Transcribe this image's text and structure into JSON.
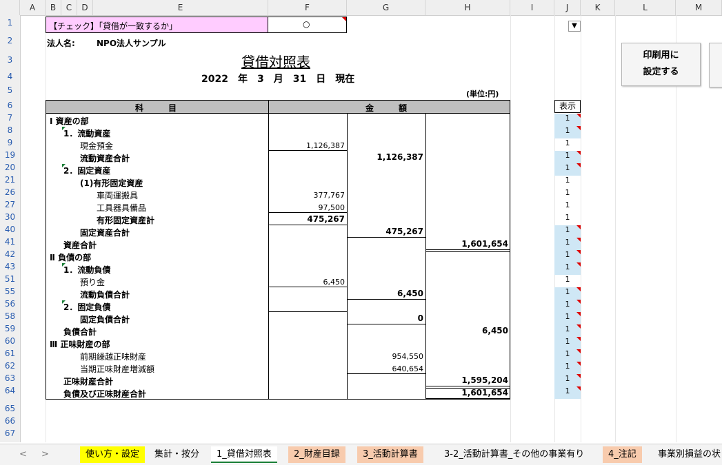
{
  "columns": [
    "A",
    "B",
    "C",
    "D",
    "E",
    "F",
    "G",
    "H",
    "I",
    "J",
    "K",
    "L",
    "M"
  ],
  "rows": [
    "1",
    "2",
    "3",
    "4",
    "5",
    "6",
    "7",
    "8",
    "9",
    "19",
    "20",
    "21",
    "26",
    "27",
    "30",
    "40",
    "41",
    "42",
    "43",
    "51",
    "55",
    "56",
    "58",
    "59",
    "60",
    "61",
    "62",
    "63",
    "64",
    "65",
    "66",
    "67"
  ],
  "check": {
    "label": "【チェック】「貸借が一致するか」",
    "result": "○"
  },
  "header": {
    "corp_label": "法人名:",
    "corp_name": "NPO法人サンプル",
    "title": "貸借対照表",
    "date": "2022　年　3　月　31　日　現在",
    "unit": "(単位:円)"
  },
  "table": {
    "col_subject": "科　　　目",
    "col_amount": "金　　　額",
    "rows": [
      {
        "label": "Ⅰ 資産の部",
        "f": "",
        "g": "",
        "h": "",
        "j": "1"
      },
      {
        "label": "1．流動資産",
        "f": "",
        "g": "",
        "h": "",
        "j": "1"
      },
      {
        "label": "現金預金",
        "f": "1,126,387",
        "g": "",
        "h": "",
        "j": "1"
      },
      {
        "label": "流動資産合計",
        "f": "",
        "g": "1,126,387",
        "h": "",
        "j": "1"
      },
      {
        "label": "2．固定資産",
        "f": "",
        "g": "",
        "h": "",
        "j": "1"
      },
      {
        "label": "(1)有形固定資産",
        "f": "",
        "g": "",
        "h": "",
        "j": "1"
      },
      {
        "label": "車両運搬具",
        "f": "377,767",
        "g": "",
        "h": "",
        "j": "1"
      },
      {
        "label": "工具器具備品",
        "f": "97,500",
        "g": "",
        "h": "",
        "j": "1"
      },
      {
        "label": "有形固定資産計",
        "f": "475,267",
        "g": "",
        "h": "",
        "j": "1"
      },
      {
        "label": "固定資産合計",
        "f": "",
        "g": "475,267",
        "h": "",
        "j": "1"
      },
      {
        "label": "資産合計",
        "f": "",
        "g": "",
        "h": "1,601,654",
        "j": "1"
      },
      {
        "label": "Ⅱ 負債の部",
        "f": "",
        "g": "",
        "h": "",
        "j": "1"
      },
      {
        "label": "1．流動負債",
        "f": "",
        "g": "",
        "h": "",
        "j": "1"
      },
      {
        "label": "預り金",
        "f": "6,450",
        "g": "",
        "h": "",
        "j": "1"
      },
      {
        "label": "流動負債合計",
        "f": "",
        "g": "6,450",
        "h": "",
        "j": "1"
      },
      {
        "label": "2．固定負債",
        "f": "",
        "g": "",
        "h": "",
        "j": "1"
      },
      {
        "label": "固定負債合計",
        "f": "",
        "g": "0",
        "h": "",
        "j": "1"
      },
      {
        "label": "負債合計",
        "f": "",
        "g": "",
        "h": "6,450",
        "j": "1"
      },
      {
        "label": "Ⅲ 正味財産の部",
        "f": "",
        "g": "",
        "h": "",
        "j": "1"
      },
      {
        "label": "前期繰越正味財産",
        "f": "",
        "g": "954,550",
        "h": "",
        "j": "1"
      },
      {
        "label": "当期正味財産増減額",
        "f": "",
        "g": "640,654",
        "h": "",
        "j": "1"
      },
      {
        "label": "正味財産合計",
        "f": "",
        "g": "",
        "h": "1,595,204",
        "j": "1"
      },
      {
        "label": "負債及び正味財産合計",
        "f": "",
        "g": "",
        "h": "1,601,654",
        "j": "1"
      }
    ]
  },
  "display_header": "表示",
  "buttons": {
    "print": "印刷用に\n設定する"
  },
  "tabs": [
    {
      "label": "使い方・設定",
      "color": "#ffff00"
    },
    {
      "label": "集計・按分",
      "color": ""
    },
    {
      "label": "1_貸借対照表",
      "color": "active"
    },
    {
      "label": "2_財産目録",
      "color": "#f8cbad"
    },
    {
      "label": "3_活動計算書",
      "color": "#f8cbad"
    },
    {
      "label": "3-2_活動計算書_その他の事業有り",
      "color": ""
    },
    {
      "label": "4_注記",
      "color": "#f8cbad"
    },
    {
      "label": "事業別損益の状",
      "color": ""
    }
  ],
  "nav": {
    "prev": "<",
    "next": ">"
  },
  "colors": {
    "pink": "#ffccff",
    "header_gray": "#bfbfbf",
    "blue": "#cfe7f5"
  }
}
